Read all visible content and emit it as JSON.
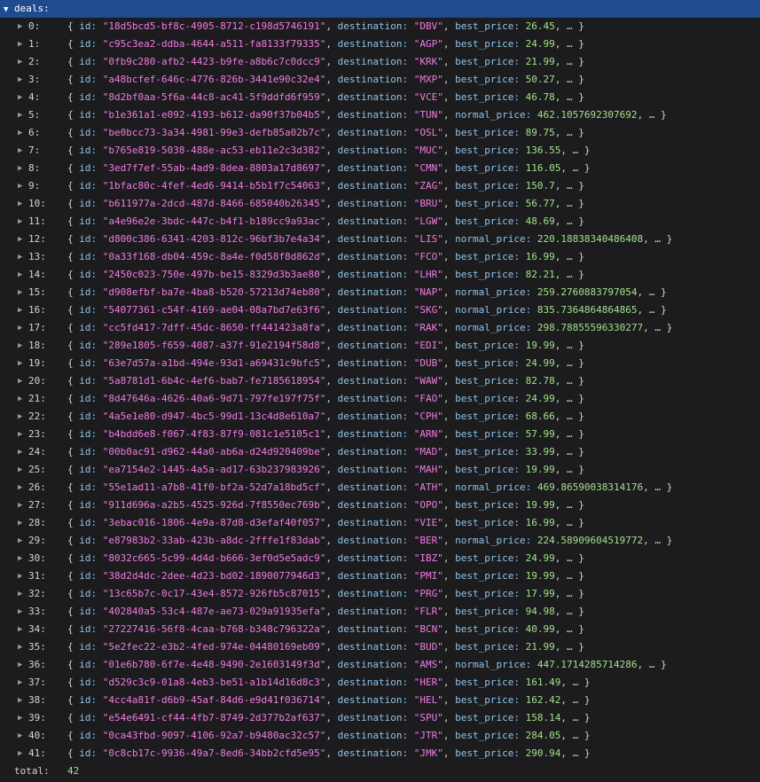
{
  "root_key": "deals:",
  "keys": {
    "id": "id:",
    "destination": "destination:"
  },
  "total": {
    "label": "total:",
    "value": "42"
  },
  "rows": [
    {
      "index": "0:",
      "id": "\"18d5bcd5-bf8c-4905-8712-c198d5746191\"",
      "destination": "\"DBV\"",
      "price_key": "best_price:",
      "price": "26.45"
    },
    {
      "index": "1:",
      "id": "\"c95c3ea2-ddba-4644-a511-fa8133f79335\"",
      "destination": "\"AGP\"",
      "price_key": "best_price:",
      "price": "24.99"
    },
    {
      "index": "2:",
      "id": "\"0fb9c280-afb2-4423-b9fe-a8b6c7c0dcc9\"",
      "destination": "\"KRK\"",
      "price_key": "best_price:",
      "price": "21.99"
    },
    {
      "index": "3:",
      "id": "\"a48bcfef-646c-4776-826b-3441e90c32e4\"",
      "destination": "\"MXP\"",
      "price_key": "best_price:",
      "price": "50.27"
    },
    {
      "index": "4:",
      "id": "\"8d2bf0aa-5f6a-44c8-ac41-5f9ddfd6f959\"",
      "destination": "\"VCE\"",
      "price_key": "best_price:",
      "price": "46.78"
    },
    {
      "index": "5:",
      "id": "\"b1e361a1-e092-4193-b612-da90f37b04b5\"",
      "destination": "\"TUN\"",
      "price_key": "normal_price:",
      "price": "462.1057692307692"
    },
    {
      "index": "6:",
      "id": "\"be0bcc73-3a34-4981-99e3-defb85a02b7c\"",
      "destination": "\"OSL\"",
      "price_key": "best_price:",
      "price": "89.75"
    },
    {
      "index": "7:",
      "id": "\"b765e819-5038-488e-ac53-eb11e2c3d382\"",
      "destination": "\"MUC\"",
      "price_key": "best_price:",
      "price": "136.55"
    },
    {
      "index": "8:",
      "id": "\"3ed7f7ef-55ab-4ad9-8dea-8803a17d8697\"",
      "destination": "\"CMN\"",
      "price_key": "best_price:",
      "price": "116.05"
    },
    {
      "index": "9:",
      "id": "\"1bfac80c-4fef-4ed6-9414-b5b1f7c54063\"",
      "destination": "\"ZAG\"",
      "price_key": "best_price:",
      "price": "150.7"
    },
    {
      "index": "10:",
      "id": "\"b611977a-2dcd-487d-8466-685040b26345\"",
      "destination": "\"BRU\"",
      "price_key": "best_price:",
      "price": "56.77"
    },
    {
      "index": "11:",
      "id": "\"a4e96e2e-3bdc-447c-b4f1-b189cc9a93ac\"",
      "destination": "\"LGW\"",
      "price_key": "best_price:",
      "price": "48.69"
    },
    {
      "index": "12:",
      "id": "\"d800c386-6341-4203-812c-96bf3b7e4a34\"",
      "destination": "\"LIS\"",
      "price_key": "normal_price:",
      "price": "220.18838340486408"
    },
    {
      "index": "13:",
      "id": "\"0a33f168-db04-459c-8a4e-f0d58f8d862d\"",
      "destination": "\"FCO\"",
      "price_key": "best_price:",
      "price": "16.99"
    },
    {
      "index": "14:",
      "id": "\"2450c023-750e-497b-be15-8329d3b3ae80\"",
      "destination": "\"LHR\"",
      "price_key": "best_price:",
      "price": "82.21"
    },
    {
      "index": "15:",
      "id": "\"d908efbf-ba7e-4ba8-b520-57213d74eb80\"",
      "destination": "\"NAP\"",
      "price_key": "normal_price:",
      "price": "259.2760883797054"
    },
    {
      "index": "16:",
      "id": "\"54077361-c54f-4169-ae04-08a7bd7e63f6\"",
      "destination": "\"SKG\"",
      "price_key": "normal_price:",
      "price": "835.7364864864865"
    },
    {
      "index": "17:",
      "id": "\"cc5fd417-7dff-45dc-8650-ff441423a8fa\"",
      "destination": "\"RAK\"",
      "price_key": "normal_price:",
      "price": "298.78855596330277"
    },
    {
      "index": "18:",
      "id": "\"289e1805-f659-4087-a37f-91e2194f58d8\"",
      "destination": "\"EDI\"",
      "price_key": "best_price:",
      "price": "19.99"
    },
    {
      "index": "19:",
      "id": "\"63e7d57a-a1bd-494e-93d1-a69431c9bfc5\"",
      "destination": "\"DUB\"",
      "price_key": "best_price:",
      "price": "24.99"
    },
    {
      "index": "20:",
      "id": "\"5a8781d1-6b4c-4ef6-bab7-fe7185618954\"",
      "destination": "\"WAW\"",
      "price_key": "best_price:",
      "price": "82.78"
    },
    {
      "index": "21:",
      "id": "\"8d47646a-4626-40a6-9d71-797fe197f75f\"",
      "destination": "\"FAO\"",
      "price_key": "best_price:",
      "price": "24.99"
    },
    {
      "index": "22:",
      "id": "\"4a5e1e80-d947-4bc5-99d1-13c4d8e610a7\"",
      "destination": "\"CPH\"",
      "price_key": "best_price:",
      "price": "68.66"
    },
    {
      "index": "23:",
      "id": "\"b4bdd6e8-f067-4f83-87f9-081c1e5105c1\"",
      "destination": "\"ARN\"",
      "price_key": "best_price:",
      "price": "57.99"
    },
    {
      "index": "24:",
      "id": "\"00b0ac91-d962-44a0-ab6a-d24d920409be\"",
      "destination": "\"MAD\"",
      "price_key": "best_price:",
      "price": "33.99"
    },
    {
      "index": "25:",
      "id": "\"ea7154e2-1445-4a5a-ad17-63b237983926\"",
      "destination": "\"MAH\"",
      "price_key": "best_price:",
      "price": "19.99"
    },
    {
      "index": "26:",
      "id": "\"55e1ad11-a7b8-41f0-bf2a-52d7a18bd5cf\"",
      "destination": "\"ATH\"",
      "price_key": "normal_price:",
      "price": "469.86590038314176"
    },
    {
      "index": "27:",
      "id": "\"911d696a-a2b5-4525-926d-7f8550ec769b\"",
      "destination": "\"OPO\"",
      "price_key": "best_price:",
      "price": "19.99"
    },
    {
      "index": "28:",
      "id": "\"3ebac016-1806-4e9a-87d8-d3efaf40f057\"",
      "destination": "\"VIE\"",
      "price_key": "best_price:",
      "price": "16.99"
    },
    {
      "index": "29:",
      "id": "\"e87983b2-33ab-423b-a8dc-2fffe1f83dab\"",
      "destination": "\"BER\"",
      "price_key": "normal_price:",
      "price": "224.58909604519772"
    },
    {
      "index": "30:",
      "id": "\"8032c665-5c99-4d4d-b666-3ef0d5e5adc9\"",
      "destination": "\"IBZ\"",
      "price_key": "best_price:",
      "price": "24.99"
    },
    {
      "index": "31:",
      "id": "\"38d2d4dc-2dee-4d23-bd02-1890077946d3\"",
      "destination": "\"PMI\"",
      "price_key": "best_price:",
      "price": "19.99"
    },
    {
      "index": "32:",
      "id": "\"13c65b7c-0c17-43e4-8572-926fb5c87015\"",
      "destination": "\"PRG\"",
      "price_key": "best_price:",
      "price": "17.99"
    },
    {
      "index": "33:",
      "id": "\"402840a5-53c4-487e-ae73-029a91935efa\"",
      "destination": "\"FLR\"",
      "price_key": "best_price:",
      "price": "94.98"
    },
    {
      "index": "34:",
      "id": "\"27227416-56f8-4caa-b768-b348c796322a\"",
      "destination": "\"BCN\"",
      "price_key": "best_price:",
      "price": "40.99"
    },
    {
      "index": "35:",
      "id": "\"5e2fec22-e3b2-4fed-974e-04480169eb09\"",
      "destination": "\"BUD\"",
      "price_key": "best_price:",
      "price": "21.99"
    },
    {
      "index": "36:",
      "id": "\"01e6b780-6f7e-4e48-9490-2e1603149f3d\"",
      "destination": "\"AMS\"",
      "price_key": "normal_price:",
      "price": "447.1714285714286"
    },
    {
      "index": "37:",
      "id": "\"d529c3c9-01a8-4eb3-be51-a1b14d16d8c3\"",
      "destination": "\"HER\"",
      "price_key": "best_price:",
      "price": "161.49"
    },
    {
      "index": "38:",
      "id": "\"4cc4a81f-d6b9-45af-84d6-e9d41f036714\"",
      "destination": "\"HEL\"",
      "price_key": "best_price:",
      "price": "162.42"
    },
    {
      "index": "39:",
      "id": "\"e54e6491-cf44-4fb7-8749-2d377b2af637\"",
      "destination": "\"SPU\"",
      "price_key": "best_price:",
      "price": "158.14"
    },
    {
      "index": "40:",
      "id": "\"0ca43fbd-9097-4106-92a7-b9480ac32c57\"",
      "destination": "\"JTR\"",
      "price_key": "best_price:",
      "price": "284.05"
    },
    {
      "index": "41:",
      "id": "\"0c8cb17c-9936-49a7-8ed6-34bb2cfd5e95\"",
      "destination": "\"JMK\"",
      "price_key": "best_price:",
      "price": "290.94"
    }
  ]
}
